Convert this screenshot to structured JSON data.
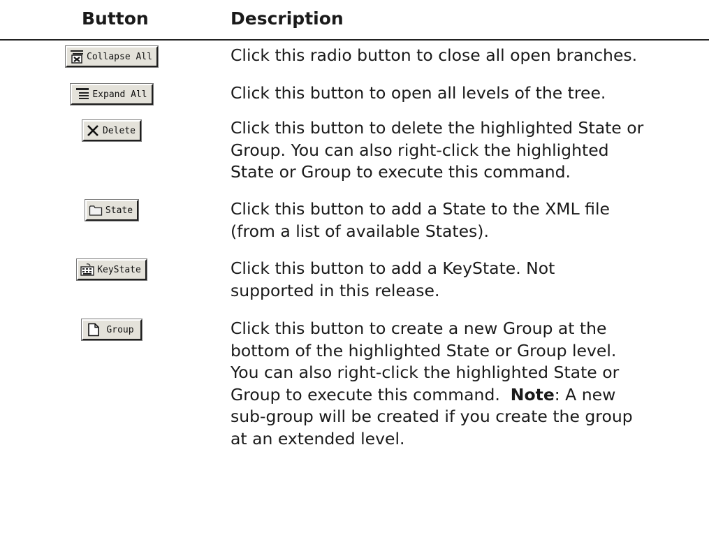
{
  "header": {
    "button_col": "Button",
    "description_col": "Description"
  },
  "rows": [
    {
      "button_label": "Collapse All",
      "icon": "collapse-all-icon",
      "description": "Click this radio button to close all open branches."
    },
    {
      "button_label": "Expand All",
      "icon": "expand-all-icon",
      "description": "Click this button to open all levels of the tree."
    },
    {
      "button_label": "Delete",
      "icon": "delete-x-icon",
      "description_lines": [
        "Click this button to delete the highlighted State or",
        "Group.  You can also right-click the highlighted",
        "State or Group to execute this command."
      ]
    },
    {
      "button_label": "State",
      "icon": "folder-icon",
      "description_lines": [
        "Click this button to add a State to the XML file",
        "(from a list of available States)."
      ]
    },
    {
      "button_label": "KeyState",
      "icon": "keyboard-icon",
      "description_lines": [
        "Click this button to add a KeyState.  Not",
        "supported in this release."
      ]
    },
    {
      "button_label": "Group",
      "icon": "document-icon",
      "description_lines": [
        "Click this button to create a new Group at the",
        "bottom of the highlighted State or Group level.",
        "You can also right-click the highlighted State or",
        "Group to execute this command."
      ],
      "note_label": "Note",
      "note_rest": ":  A new",
      "description_tail_lines": [
        "sub-group will be created if you create the group",
        "at an extended level."
      ]
    }
  ],
  "colors": {
    "button_face": "#e4e2da",
    "text": "#1a1a1a",
    "rule": "#222222"
  }
}
